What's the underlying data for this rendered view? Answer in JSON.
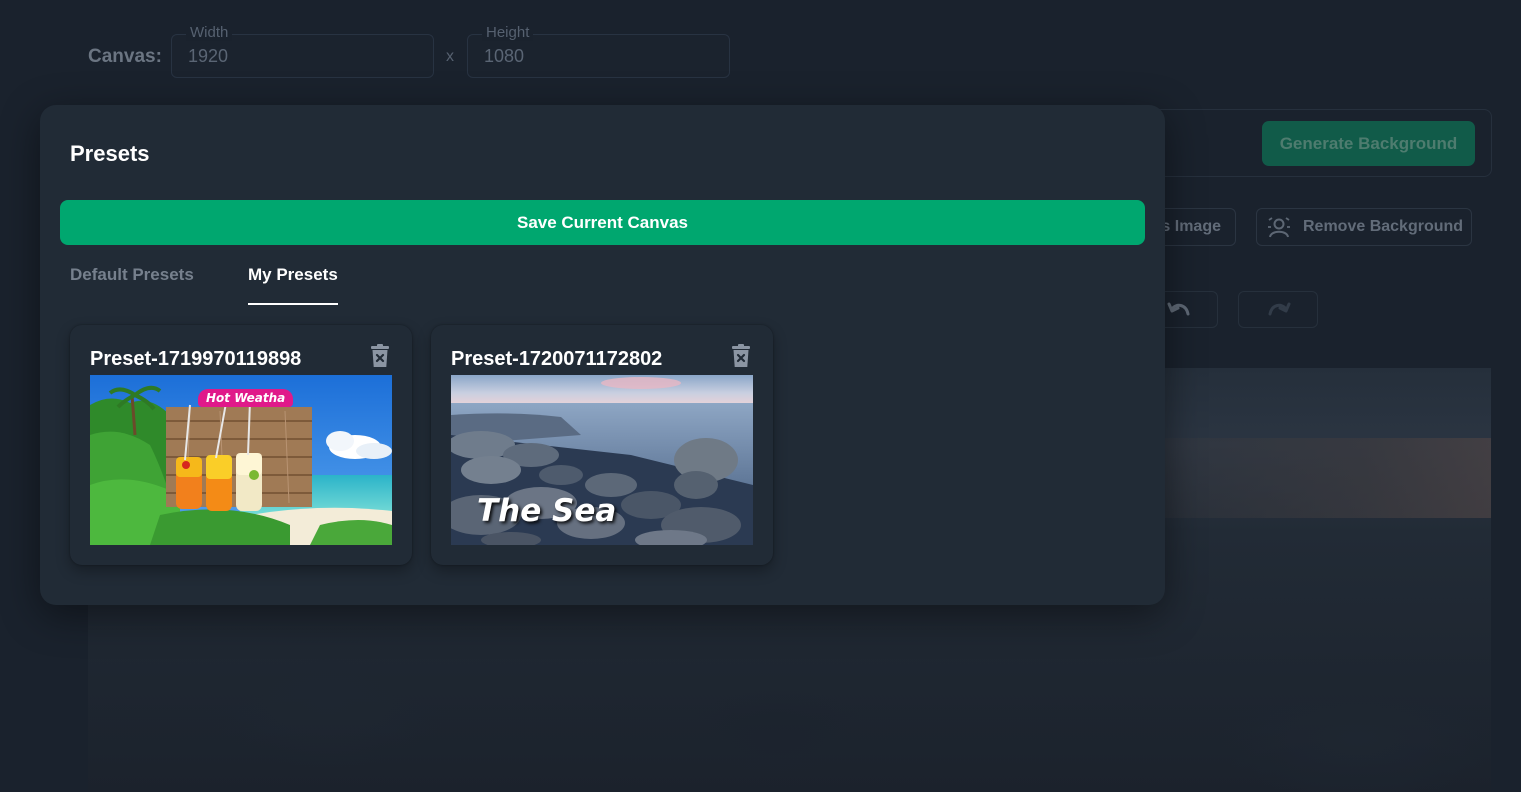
{
  "canvas": {
    "label": "Canvas:",
    "width_legend": "Width",
    "width_value": "1920",
    "separator": "x",
    "height_legend": "Height",
    "height_value": "1080"
  },
  "toolbar": {
    "generate_label": "Generate Background",
    "alias_label": "s Image",
    "remove_bg_label": "Remove Background"
  },
  "modal": {
    "title": "Presets",
    "save_label": "Save Current Canvas",
    "tabs": [
      {
        "label": "Default Presets",
        "active": false
      },
      {
        "label": "My Presets",
        "active": true
      }
    ],
    "presets": [
      {
        "name": "Preset-1719970119898",
        "thumb_text": "Hot Weatha"
      },
      {
        "name": "Preset-1720071172802",
        "thumb_text": "The Sea"
      }
    ]
  },
  "colors": {
    "accent": "#00a76f",
    "modal_bg": "#212b36",
    "page_bg": "#1a222d"
  }
}
